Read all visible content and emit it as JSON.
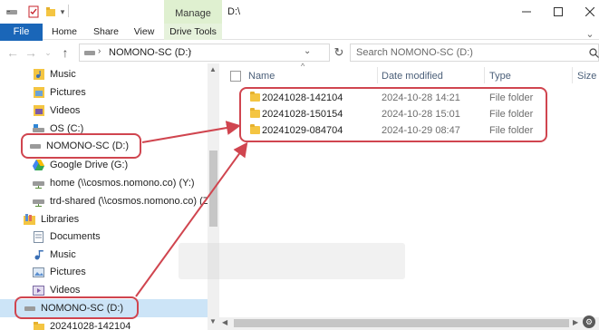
{
  "title_bar": {
    "manage_tab": "Manage",
    "path_title": "D:\\"
  },
  "ribbon": {
    "file_tab": "File",
    "tabs": [
      "Home",
      "Share",
      "View",
      "Drive Tools"
    ]
  },
  "address": {
    "path": "NOMONO-SC (D:)",
    "search_placeholder": "Search NOMONO-SC (D:)"
  },
  "nav_tree": [
    {
      "label": "Music",
      "icon": "music-icon"
    },
    {
      "label": "Pictures",
      "icon": "pictures-icon"
    },
    {
      "label": "Videos",
      "icon": "videos-icon"
    },
    {
      "label": "OS (C:)",
      "icon": "os-drive-icon"
    },
    {
      "label": "NOMONO-SC (D:)",
      "icon": "drive-icon"
    },
    {
      "label": "Google Drive (G:)",
      "icon": "google-drive-icon"
    },
    {
      "label": "home (\\\\cosmos.nomono.co) (Y:)",
      "icon": "network-drive-icon"
    },
    {
      "label": "trd-shared (\\\\cosmos.nomono.co) (Z:)",
      "icon": "network-drive-icon"
    },
    {
      "label": "Libraries",
      "icon": "libraries-icon"
    },
    {
      "label": "Documents",
      "icon": "documents-icon"
    },
    {
      "label": "Music",
      "icon": "music-icon"
    },
    {
      "label": "Pictures",
      "icon": "pictures-icon"
    },
    {
      "label": "Videos",
      "icon": "videos-icon"
    },
    {
      "label": "NOMONO-SC (D:)",
      "icon": "drive-icon"
    },
    {
      "label": "20241028-142104",
      "icon": "folder-icon"
    }
  ],
  "columns": {
    "name": "Name",
    "date": "Date modified",
    "type": "Type",
    "size": "Size"
  },
  "files": [
    {
      "name": "20241028-142104",
      "date": "2024-10-28 14:21",
      "type": "File folder"
    },
    {
      "name": "20241028-150154",
      "date": "2024-10-28 15:01",
      "type": "File folder"
    },
    {
      "name": "20241029-084704",
      "date": "2024-10-29 08:47",
      "type": "File folder"
    }
  ],
  "colors": {
    "annotation": "#d0454f",
    "file_tab": "#1a66b8",
    "manage_tab": "#dff0d0",
    "selected": "#cce4f7",
    "folder": "#f4c542"
  }
}
